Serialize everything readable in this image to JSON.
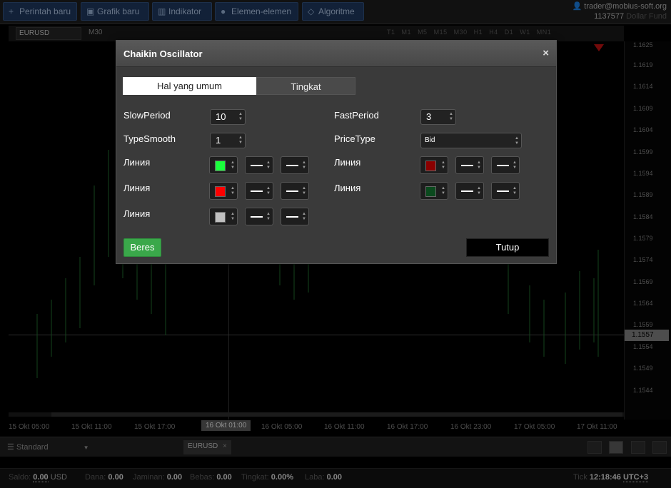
{
  "topbar": {
    "buttons": [
      {
        "label": "Perintah baru",
        "icon": "plus-icon"
      },
      {
        "label": "Grafik baru",
        "icon": "chart-icon"
      },
      {
        "label": "Indikator",
        "icon": "bars-icon"
      },
      {
        "label": "Elemen-elemen",
        "icon": "shapes-icon"
      },
      {
        "label": "Algoritme",
        "icon": "diamond-icon"
      }
    ],
    "account_email": "trader@mobius-soft.org",
    "account_id": "1137577",
    "account_fund": "Dollar Fund"
  },
  "chartbar": {
    "symbol": "EURUSD",
    "timeframe": "M30",
    "timeframes": [
      "T1",
      "M1",
      "M5",
      "M15",
      "M30",
      "H1",
      "H4",
      "D1",
      "W1",
      "MN1"
    ]
  },
  "price_axis": {
    "ticks": [
      "1.1625",
      "1.1619",
      "1.1614",
      "1.1609",
      "1.1604",
      "1.1599",
      "1.1594",
      "1.1589",
      "1.1584",
      "1.1579",
      "1.1574",
      "1.1569",
      "1.1564",
      "1.1559",
      "1.1554",
      "1.1549",
      "1.1544"
    ],
    "current": "1.1557"
  },
  "time_axis": {
    "ticks": [
      "15 Okt 05:00",
      "15 Okt 11:00",
      "15 Okt 17:00",
      "16 Okt 01:00",
      "16 Okt 05:00",
      "16 Okt 11:00",
      "16 Okt 17:00",
      "16 Okt 23:00",
      "17 Okt 05:00",
      "17 Okt 11:00"
    ]
  },
  "bottombar": {
    "layout": "Standard",
    "symbol_tab": "EURUSD"
  },
  "status": {
    "saldo_label": "Saldo:",
    "saldo_value": "0.00",
    "saldo_currency": "USD",
    "dana_label": "Dana:",
    "dana_value": "0.00",
    "jaminan_label": "Jaminan:",
    "jaminan_value": "0.00",
    "bebas_label": "Bebas:",
    "bebas_value": "0.00",
    "tingkat_label": "Tingkat:",
    "tingkat_value": "0.00%",
    "laba_label": "Laba:",
    "laba_value": "0.00",
    "tick_label": "Tick",
    "time": "12:18:46",
    "tz": "UTC+3"
  },
  "modal": {
    "title": "Chaikin Oscillator",
    "close": "×",
    "tabs": [
      "Hal yang umum",
      "Tingkat"
    ],
    "slow_period_label": "SlowPeriod",
    "slow_period": "10",
    "fast_period_label": "FastPeriod",
    "fast_period": "3",
    "type_smooth_label": "TypeSmooth",
    "type_smooth": "1",
    "price_type_label": "PriceType",
    "price_type": "Bid",
    "line_label": "Линия",
    "left_lines": [
      {
        "color": "#19ff3c"
      },
      {
        "color": "#ff0000"
      },
      {
        "color": "#c0c0c0"
      }
    ],
    "right_lines": [
      {
        "color": "#8b0000"
      },
      {
        "color": "#0b4a1e"
      }
    ],
    "ok_label": "Beres",
    "close_label": "Tutup"
  }
}
